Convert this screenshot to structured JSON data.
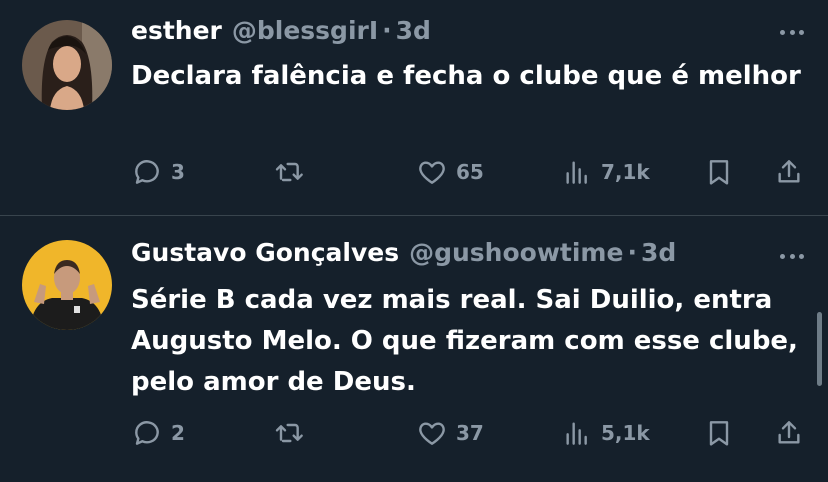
{
  "tweets": [
    {
      "name": "esther",
      "handle": "@blessgirI",
      "separator": "·",
      "time": "3d",
      "text": "Declara falência e fecha o clube que é melhor",
      "replies": "3",
      "retweets": "",
      "likes": "65",
      "views": "7,1k",
      "avatar_colors": {
        "bg": "#6b5a4c",
        "hair": "#2a1f1a",
        "skin": "#d9a888"
      }
    },
    {
      "name": "Gustavo Gonçalves",
      "handle": "@gushoowtime",
      "separator": "·",
      "time": "3d",
      "text": "Série B cada vez mais real. Sai Duilio, entra Augusto Melo. O que fizeram com esse clube, pelo amor de Deus.",
      "replies": "2",
      "retweets": "",
      "likes": "37",
      "views": "5,1k",
      "avatar_colors": {
        "bg": "#f0b62a",
        "shirt": "#1c1c1c",
        "skin": "#c79a7c"
      }
    }
  ],
  "icons": [
    "reply-icon",
    "retweet-icon",
    "like-icon",
    "views-icon",
    "bookmark-icon",
    "share-icon",
    "more-icon"
  ],
  "colors": {
    "background": "#15202b",
    "muted": "#8b98a5",
    "divider": "#38444d",
    "text": "#ffffff"
  }
}
